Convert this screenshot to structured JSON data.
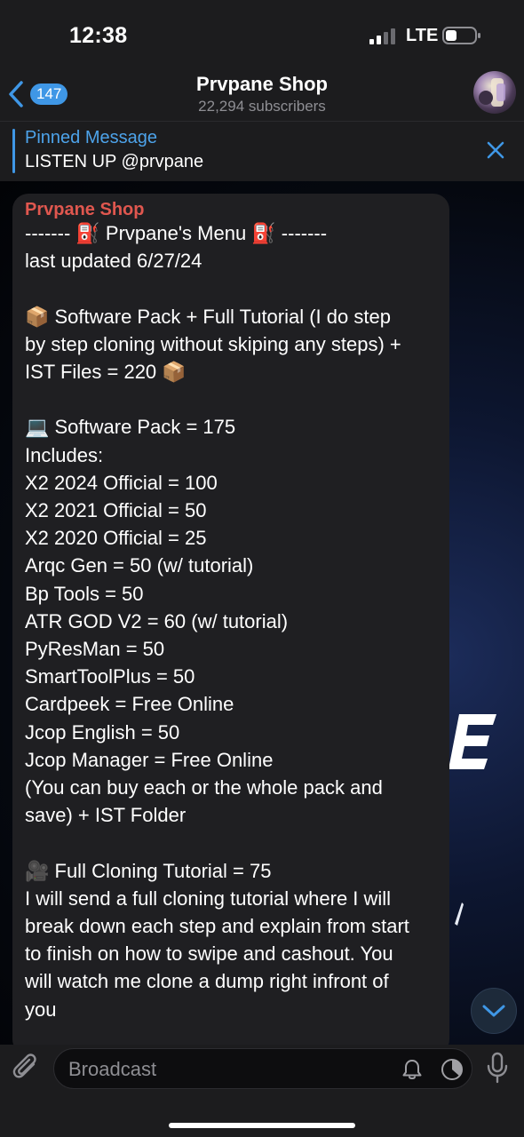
{
  "status_bar": {
    "time": "12:38",
    "network": "LTE",
    "signal_bars_filled": 2,
    "signal_bars_total": 4
  },
  "header": {
    "back_count": "147",
    "channel_name": "Prvpane Shop",
    "subscribers": "22,294 subscribers"
  },
  "pinned": {
    "title": "Pinned Message",
    "text": "LISTEN UP @prvpane"
  },
  "message": {
    "sender": "Prvpane Shop",
    "lines": [
      "------- ⛽ Prvpane's Menu ⛽ -------",
      "last updated 6/27/24",
      "",
      "📦 Software Pack + Full Tutorial (I do step",
      "by step cloning without skiping any steps) +",
      "IST Files = 220 📦",
      "",
      "💻 Software Pack = 175",
      "Includes:",
      "X2 2024 Official = 100",
      "X2 2021 Official = 50",
      "X2 2020 Official = 25",
      "Arqc Gen = 50 (w/ tutorial)",
      "Bp Tools = 50",
      "ATR GOD V2 = 60 (w/ tutorial)",
      "PyResMan = 50",
      "SmartToolPlus = 50",
      "Cardpeek = Free Online",
      "Jcop English = 50",
      "Jcop Manager = Free Online",
      "(You can buy each or the whole pack and",
      "save) + IST Folder",
      "",
      "🎥 Full Cloning Tutorial = 75",
      "I will send a full cloning tutorial where I will",
      "break down each step and explain from start",
      "to finish on how to swipe and cashout. You",
      "will watch me clone a dump right infront of",
      "you"
    ]
  },
  "composer": {
    "placeholder": "Broadcast"
  },
  "colors": {
    "accent": "#3f97e6",
    "sender": "#e0574f",
    "bubble": "#1f1f22",
    "bar": "#1c1c1e"
  },
  "icons": {
    "back": "chevron-left-icon",
    "close": "close-icon",
    "attach": "paperclip-icon",
    "notifications": "bell-icon",
    "timer": "timer-icon",
    "voice": "microphone-icon",
    "scroll": "chevron-down-icon"
  }
}
